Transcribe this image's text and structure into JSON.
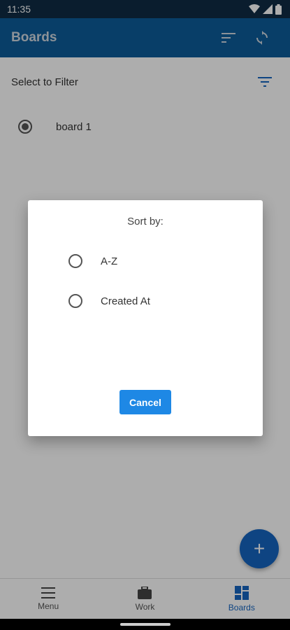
{
  "status_bar": {
    "time": "11:35"
  },
  "app_bar": {
    "title": "Boards"
  },
  "filter": {
    "label": "Select to Filter"
  },
  "boards": [
    {
      "label": "board 1",
      "selected": true
    }
  ],
  "dialog": {
    "title": "Sort by:",
    "options": [
      {
        "label": "A-Z"
      },
      {
        "label": "Created At"
      }
    ],
    "cancel_label": "Cancel"
  },
  "fab": {
    "label": "+"
  },
  "bottom_nav": {
    "items": [
      {
        "label": "Menu",
        "icon": "menu-icon"
      },
      {
        "label": "Work",
        "icon": "briefcase-icon"
      },
      {
        "label": "Boards",
        "icon": "dashboard-icon",
        "active": true
      }
    ]
  },
  "colors": {
    "app_bar": "#0d5c9a",
    "status_bar": "#0f2c45",
    "accent": "#1e88e5",
    "fab": "#1565c0"
  }
}
